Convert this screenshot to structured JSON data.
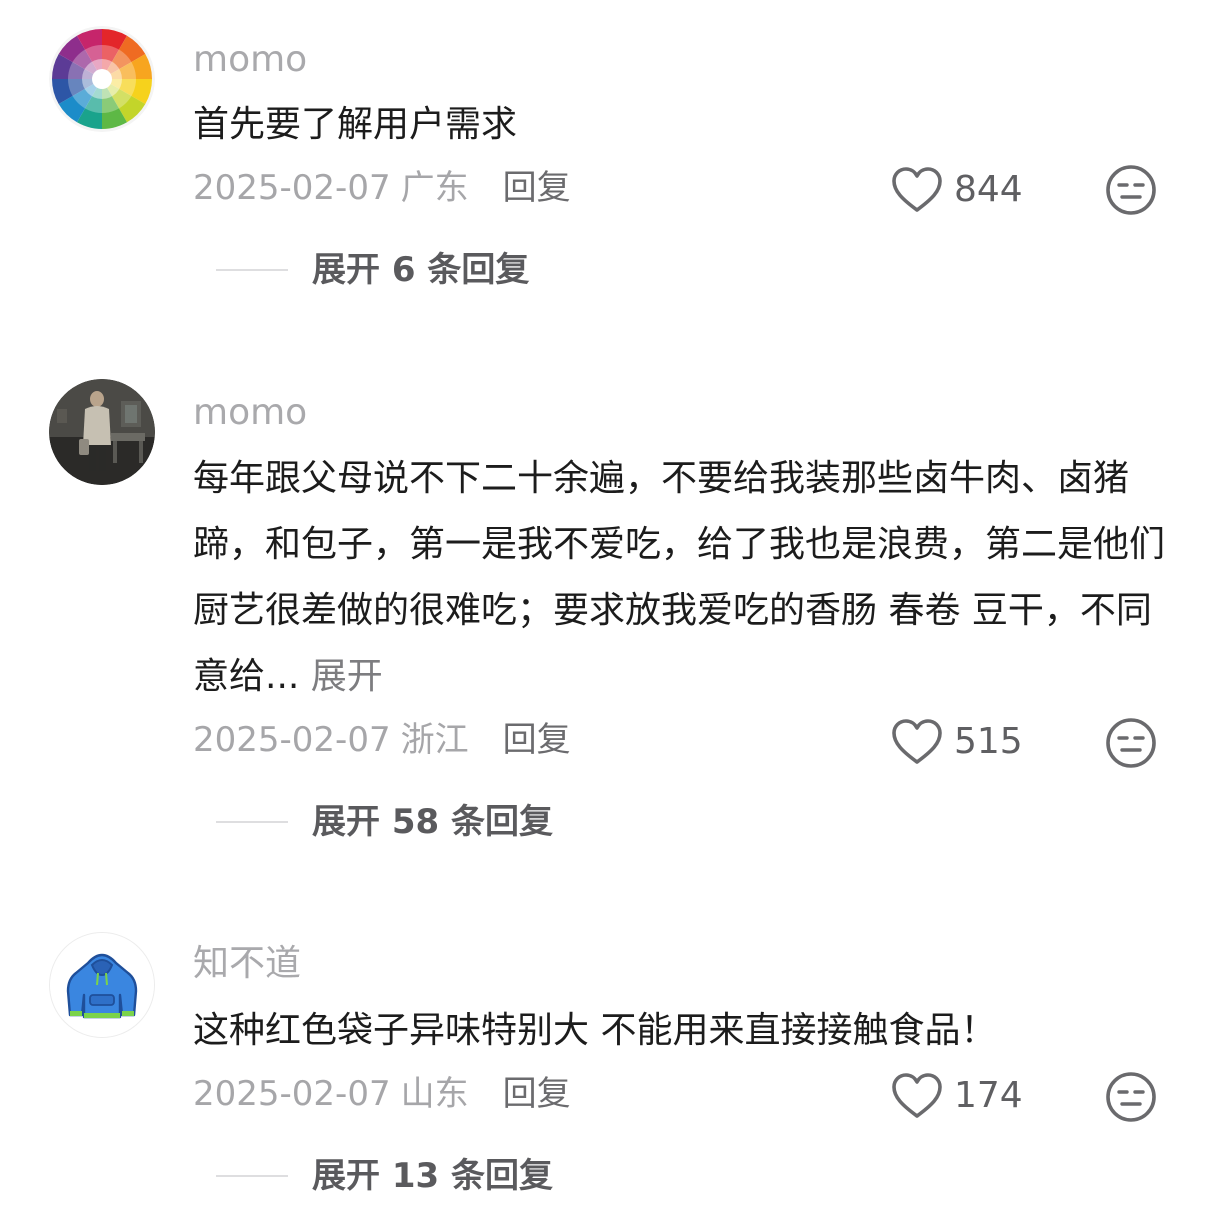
{
  "comments": [
    {
      "username": "momo",
      "text": "首先要了解用户需求",
      "expand_text": "",
      "date": "2025-02-07",
      "location": "广东",
      "reply_label": "回复",
      "likes": "844",
      "expand_replies_label": "展开 6 条回复",
      "avatar": "color-wheel-avatar"
    },
    {
      "username": "momo",
      "text": "每年跟父母说不下二十余遍，不要给我装那些卤牛肉、卤猪蹄，和包子，第一是我不爱吃，给了我也是浪费，第二是他们厨艺很差做的很难吃；要求放我爱吃的香肠 春卷 豆干，不同意给...",
      "expand_text": " 展开",
      "date": "2025-02-07",
      "location": "浙江",
      "reply_label": "回复",
      "likes": "515",
      "expand_replies_label": "展开 58 条回复",
      "avatar": "photo-avatar"
    },
    {
      "username": "知不道",
      "text": "这种红色袋子异味特别大 不能用来直接接触食品！",
      "expand_text": "",
      "date": "2025-02-07",
      "location": "山东",
      "reply_label": "回复",
      "likes": "174",
      "expand_replies_label": "展开 13 条回复",
      "avatar": "blue-hoodie-avatar"
    }
  ],
  "colors": {
    "username": "#a9a9ac",
    "meta": "#a6a6a9",
    "text": "#1c1c1c",
    "icon": "#6a6a6d"
  }
}
